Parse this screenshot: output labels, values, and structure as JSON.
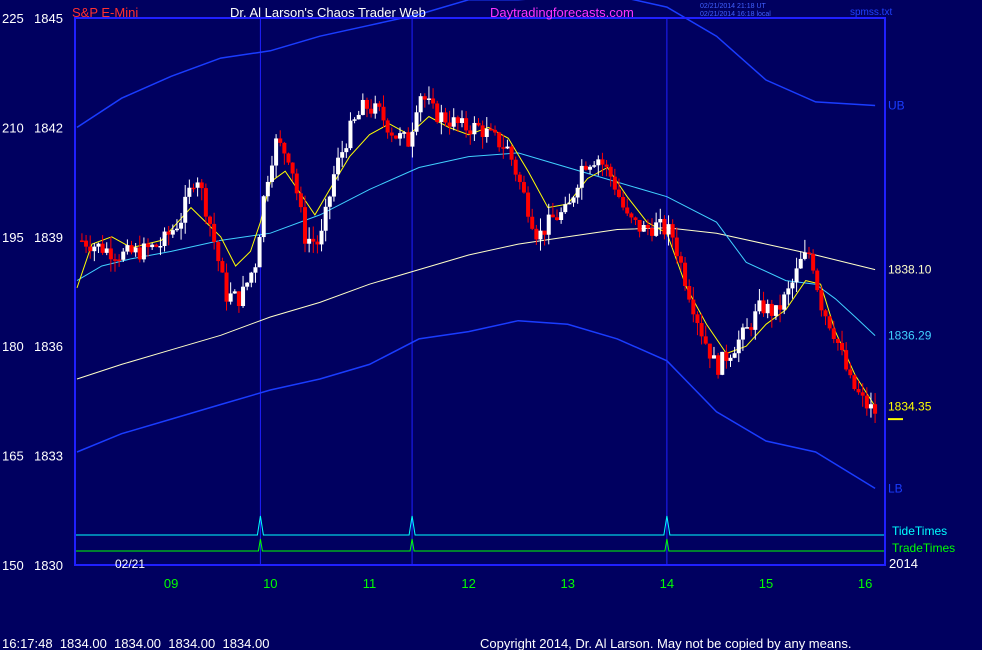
{
  "header": {
    "symbol": "S&P E-Mini",
    "title": "Dr. Al Larson's Chaos Trader Web",
    "site": "Daytradingforecasts.com",
    "stamp_utc": "02/21/2014 21:18 UT",
    "stamp_local": "02/21/2014 16:18 local",
    "file": "spmss.txt"
  },
  "footer": {
    "quote": "16:17:48  1834.00  1834.00  1834.00  1834.00",
    "copyright": "Copyright 2014, Dr. Al Larson. May not be copied by any means."
  },
  "colors": {
    "background": "#000060",
    "frame": "#2020ff",
    "band": "#1a3cff",
    "ma_slow": "#ffffc8",
    "ma_mid": "#40d0ff",
    "ma_fast": "#ffff00",
    "up_candle": "#ffffff",
    "down_candle": "#ff0000",
    "tide": "#00ffff",
    "trade": "#00ff00",
    "axis_text": "#ffffff",
    "time_text": "#00ff00"
  },
  "chart_data": {
    "type": "line",
    "ylim": [
      1830,
      1845
    ],
    "scale_labels": [
      {
        "left": "150",
        "right": "1830",
        "price": 1830
      },
      {
        "left": "165",
        "right": "1833",
        "price": 1833
      },
      {
        "left": "180",
        "right": "1836",
        "price": 1836
      },
      {
        "left": "195",
        "right": "1839",
        "price": 1839
      },
      {
        "left": "210",
        "right": "1842",
        "price": 1842
      },
      {
        "left": "225",
        "right": "1845",
        "price": 1845
      }
    ],
    "xlim": [
      8.03,
      16.2
    ],
    "x_ticks": [
      {
        "label": "09",
        "hour": 9
      },
      {
        "label": "10",
        "hour": 10
      },
      {
        "label": "11",
        "hour": 11
      },
      {
        "label": "12",
        "hour": 12
      },
      {
        "label": "13",
        "hour": 13
      },
      {
        "label": "14",
        "hour": 14
      },
      {
        "label": "15",
        "hour": 15
      },
      {
        "label": "16",
        "hour": 16
      }
    ],
    "date_label": "02/21",
    "year_label": "2014",
    "tide_times": [
      9.9,
      11.43,
      14.0
    ],
    "lines": [
      {
        "label": "1838.10",
        "value": 1838.1,
        "color": "#ffffc8",
        "points": [
          [
            8.05,
            1835.1
          ],
          [
            8.5,
            1835.5
          ],
          [
            9,
            1835.9
          ],
          [
            9.5,
            1836.3
          ],
          [
            10,
            1836.8
          ],
          [
            10.5,
            1837.2
          ],
          [
            11,
            1837.7
          ],
          [
            11.5,
            1838.1
          ],
          [
            12,
            1838.5
          ],
          [
            12.5,
            1838.8
          ],
          [
            13,
            1839
          ],
          [
            13.5,
            1839.2
          ],
          [
            14,
            1839.25
          ],
          [
            14.5,
            1839.1
          ],
          [
            15,
            1838.8
          ],
          [
            15.5,
            1838.5
          ],
          [
            16.1,
            1838.1
          ]
        ]
      },
      {
        "label": "1836.29",
        "value": 1836.29,
        "color": "#40d0ff",
        "points": [
          [
            8.05,
            1837.8
          ],
          [
            8.3,
            1838.2
          ],
          [
            8.6,
            1838.4
          ],
          [
            9,
            1838.6
          ],
          [
            9.5,
            1838.9
          ],
          [
            10,
            1839.1
          ],
          [
            10.5,
            1839.6
          ],
          [
            11,
            1840.3
          ],
          [
            11.5,
            1840.9
          ],
          [
            12,
            1841.2
          ],
          [
            12.5,
            1841.3
          ],
          [
            13,
            1840.9
          ],
          [
            13.5,
            1840.5
          ],
          [
            14,
            1840.1
          ],
          [
            14.5,
            1839.4
          ],
          [
            14.8,
            1838.3
          ],
          [
            15.2,
            1837.8
          ],
          [
            15.5,
            1837.7
          ],
          [
            15.7,
            1837.3
          ],
          [
            15.9,
            1836.8
          ],
          [
            16.1,
            1836.29
          ]
        ]
      },
      {
        "label": "1834.35",
        "value": 1834.35,
        "color": "#ffff00",
        "points": [
          [
            8.05,
            1837.6
          ],
          [
            8.2,
            1838.8
          ],
          [
            8.4,
            1839
          ],
          [
            8.6,
            1838.7
          ],
          [
            8.9,
            1838.9
          ],
          [
            9.2,
            1839.8
          ],
          [
            9.5,
            1839
          ],
          [
            9.65,
            1838.2
          ],
          [
            9.8,
            1838.6
          ],
          [
            9.9,
            1839.4
          ],
          [
            10,
            1840.5
          ],
          [
            10.15,
            1840.8
          ],
          [
            10.3,
            1840.2
          ],
          [
            10.45,
            1839.6
          ],
          [
            10.6,
            1840.3
          ],
          [
            10.8,
            1841.2
          ],
          [
            11,
            1841.8
          ],
          [
            11.2,
            1842.1
          ],
          [
            11.4,
            1841.8
          ],
          [
            11.6,
            1842.3
          ],
          [
            11.8,
            1842
          ],
          [
            12,
            1841.8
          ],
          [
            12.2,
            1842
          ],
          [
            12.4,
            1841.7
          ],
          [
            12.6,
            1840.8
          ],
          [
            12.8,
            1839.8
          ],
          [
            13,
            1839.9
          ],
          [
            13.2,
            1840.6
          ],
          [
            13.4,
            1840.9
          ],
          [
            13.6,
            1840.1
          ],
          [
            13.8,
            1839.4
          ],
          [
            14,
            1839.1
          ],
          [
            14.2,
            1837.6
          ],
          [
            14.4,
            1836.6
          ],
          [
            14.6,
            1835.8
          ],
          [
            14.8,
            1836
          ],
          [
            15,
            1836.6
          ],
          [
            15.2,
            1837
          ],
          [
            15.4,
            1837.8
          ],
          [
            15.55,
            1837.7
          ],
          [
            15.7,
            1836.4
          ],
          [
            15.9,
            1835.2
          ],
          [
            16.1,
            1834.35
          ]
        ]
      },
      {
        "label": "UB",
        "value": 1842.6,
        "color": "#1a3cff",
        "points": [
          [
            8.05,
            1842
          ],
          [
            8.5,
            1842.8
          ],
          [
            9,
            1843.4
          ],
          [
            9.5,
            1843.9
          ],
          [
            10,
            1844.1
          ],
          [
            10.5,
            1844.5
          ],
          [
            11,
            1844.8
          ],
          [
            11.5,
            1845.1
          ],
          [
            12,
            1845.5
          ],
          [
            12.5,
            1845.5
          ],
          [
            13,
            1845.6
          ],
          [
            13.5,
            1845.6
          ],
          [
            14,
            1845.3
          ],
          [
            14.5,
            1844.5
          ],
          [
            15,
            1843.3
          ],
          [
            15.5,
            1842.7
          ],
          [
            16.1,
            1842.6
          ]
        ]
      },
      {
        "label": "LB",
        "value": 1832.1,
        "color": "#1a3cff",
        "points": [
          [
            8.05,
            1833.1
          ],
          [
            8.5,
            1833.6
          ],
          [
            9,
            1834
          ],
          [
            9.5,
            1834.4
          ],
          [
            10,
            1834.8
          ],
          [
            10.5,
            1835.1
          ],
          [
            11,
            1835.5
          ],
          [
            11.5,
            1836.2
          ],
          [
            12,
            1836.4
          ],
          [
            12.5,
            1836.7
          ],
          [
            13,
            1836.6
          ],
          [
            13.5,
            1836.2
          ],
          [
            14,
            1835.6
          ],
          [
            14.5,
            1834.2
          ],
          [
            15,
            1833.4
          ],
          [
            15.5,
            1833.1
          ],
          [
            16.1,
            1832.1
          ]
        ]
      }
    ],
    "tide_label": "TideTimes",
    "trade_label": "TradeTimes",
    "candle_anchors": [
      [
        8.1,
        1838.9
      ],
      [
        8.3,
        1838.7
      ],
      [
        8.5,
        1838.5
      ],
      [
        8.7,
        1838.6
      ],
      [
        8.9,
        1838.8
      ],
      [
        9.1,
        1839.5
      ],
      [
        9.25,
        1840.8
      ],
      [
        9.4,
        1839.3
      ],
      [
        9.55,
        1837.4
      ],
      [
        9.7,
        1837.3
      ],
      [
        9.85,
        1838.3
      ],
      [
        9.95,
        1840.4
      ],
      [
        10.05,
        1841.6
      ],
      [
        10.2,
        1841.2
      ],
      [
        10.35,
        1839
      ],
      [
        10.5,
        1838.8
      ],
      [
        10.65,
        1840.8
      ],
      [
        10.8,
        1841.9
      ],
      [
        10.95,
        1842.6
      ],
      [
        11.1,
        1842.4
      ],
      [
        11.25,
        1841.8
      ],
      [
        11.4,
        1841.6
      ],
      [
        11.5,
        1843
      ],
      [
        11.65,
        1842.4
      ],
      [
        11.8,
        1842.2
      ],
      [
        11.95,
        1842
      ],
      [
        12.1,
        1842
      ],
      [
        12.25,
        1841.7
      ],
      [
        12.4,
        1841.4
      ],
      [
        12.55,
        1840.2
      ],
      [
        12.7,
        1839
      ],
      [
        12.85,
        1839.5
      ],
      [
        13,
        1839.7
      ],
      [
        13.15,
        1841
      ],
      [
        13.3,
        1841.2
      ],
      [
        13.45,
        1840.6
      ],
      [
        13.6,
        1839.5
      ],
      [
        13.75,
        1839.2
      ],
      [
        13.9,
        1839.3
      ],
      [
        14.05,
        1839.1
      ],
      [
        14.2,
        1837.7
      ],
      [
        14.35,
        1836.4
      ],
      [
        14.5,
        1835.4
      ],
      [
        14.65,
        1835.9
      ],
      [
        14.8,
        1836.4
      ],
      [
        14.95,
        1837.1
      ],
      [
        15.1,
        1836.9
      ],
      [
        15.25,
        1837.6
      ],
      [
        15.35,
        1838.3
      ],
      [
        15.45,
        1838.6
      ],
      [
        15.55,
        1837.2
      ],
      [
        15.7,
        1836.3
      ],
      [
        15.85,
        1835
      ],
      [
        16,
        1834.4
      ],
      [
        16.1,
        1834.2
      ]
    ]
  }
}
